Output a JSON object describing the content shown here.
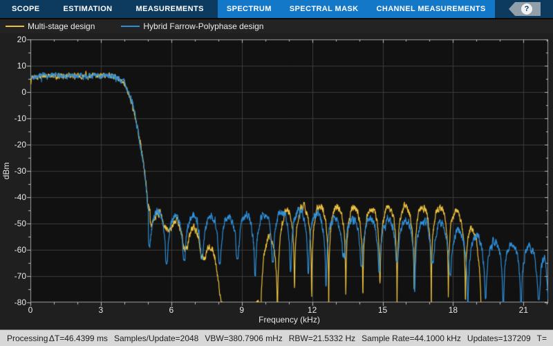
{
  "toolbar": {
    "tabs": [
      {
        "label": "SCOPE",
        "group": "main"
      },
      {
        "label": "ESTIMATION",
        "group": "main"
      },
      {
        "label": "MEASUREMENTS",
        "group": "main"
      },
      {
        "label": "SPECTRUM",
        "group": "contextual"
      },
      {
        "label": "SPECTRAL MASK",
        "group": "contextual"
      },
      {
        "label": "CHANNEL MEASUREMENTS",
        "group": "contextual"
      }
    ],
    "help_label": "?",
    "colors": {
      "main_bg": "#0d3b5f",
      "contextual_bg": "#1478c8"
    }
  },
  "legend": {
    "items": [
      {
        "label": "Multi-stage design",
        "color": "#EDC240"
      },
      {
        "label": "Hybrid Farrow-Polyphase design",
        "color": "#2E8FD9"
      }
    ]
  },
  "chart_data": {
    "type": "line",
    "title": "",
    "xlabel": "Frequency (kHz)",
    "ylabel": "dBm",
    "xlim": [
      0,
      22.05
    ],
    "ylim": [
      -80,
      20
    ],
    "x_ticks": [
      0,
      3,
      6,
      9,
      12,
      15,
      18,
      21
    ],
    "y_ticks": [
      20,
      10,
      0,
      -10,
      -20,
      -30,
      -40,
      -50,
      -60,
      -70,
      -80
    ],
    "x_minor_step": 1,
    "y_minor_step": 5,
    "grid": true,
    "legend_position": "top-left",
    "plot_bg": "#111111",
    "grid_color": "#3c3c3c",
    "axis_color": "#9e9e9e",
    "tick_color": "#c0c0c0",
    "series": [
      {
        "name": "Multi-stage design",
        "color": "#EDC240",
        "seed": 13,
        "envelope": [
          [
            0,
            5.8
          ],
          [
            0.6,
            6
          ],
          [
            1.6,
            6.1
          ],
          [
            2.6,
            6.2
          ],
          [
            3.4,
            6.2
          ],
          [
            3.75,
            5.2
          ],
          [
            4.05,
            2.5
          ],
          [
            4.3,
            -3
          ],
          [
            4.55,
            -13
          ],
          [
            4.75,
            -23
          ],
          [
            4.9,
            -33
          ],
          [
            5.0,
            -42
          ],
          [
            5.1,
            -45
          ],
          [
            5.4,
            -45.5
          ],
          [
            5.9,
            -47.5
          ],
          [
            6.4,
            -49.5
          ],
          [
            6.9,
            -51.5
          ],
          [
            7.3,
            -54
          ],
          [
            7.7,
            -58.5
          ],
          [
            7.95,
            -64
          ],
          [
            8.1,
            -73
          ],
          [
            8.2,
            -85
          ],
          [
            8.3,
            -97
          ],
          [
            9.4,
            -97
          ],
          [
            9.55,
            -84
          ],
          [
            9.7,
            -70
          ],
          [
            9.95,
            -58
          ],
          [
            10.2,
            -54.5
          ],
          [
            10.45,
            -56
          ],
          [
            10.65,
            -49
          ],
          [
            10.95,
            -44.5
          ],
          [
            11.4,
            -43.5
          ],
          [
            12.2,
            -43.5
          ],
          [
            13,
            -43.5
          ],
          [
            14,
            -44
          ],
          [
            15,
            -44
          ],
          [
            16,
            -43.5
          ],
          [
            17,
            -44
          ],
          [
            17.7,
            -43.5
          ],
          [
            18.05,
            -45
          ],
          [
            18.4,
            -46.5
          ],
          [
            18.75,
            -50
          ],
          [
            19.0,
            -56
          ],
          [
            19.15,
            -64
          ],
          [
            19.25,
            -78
          ],
          [
            19.35,
            -97
          ],
          [
            22.05,
            -97
          ]
        ],
        "lobes": [
          {
            "from": 5.1,
            "to": 8.15,
            "period": 0.76,
            "f0": 5.08,
            "dmin": 4,
            "dmax": 9
          },
          {
            "from": 9.6,
            "to": 19.3,
            "period": 0.728,
            "f0": 10.52,
            "dmin": 28,
            "dmax": 45
          }
        ],
        "noise": {
          "passband": 0.85,
          "stopband": 1.15,
          "split": 4.25
        }
      },
      {
        "name": "Hybrid Farrow-Polyphase design",
        "color": "#2E8FD9",
        "seed": 7,
        "envelope": [
          [
            0,
            5.8
          ],
          [
            0.5,
            6
          ],
          [
            1.5,
            6.2
          ],
          [
            2.5,
            6.1
          ],
          [
            3.3,
            6.3
          ],
          [
            3.7,
            5.5
          ],
          [
            4.0,
            3.5
          ],
          [
            4.25,
            -1
          ],
          [
            4.5,
            -11
          ],
          [
            4.7,
            -21
          ],
          [
            4.85,
            -30
          ],
          [
            5.0,
            -43
          ],
          [
            5.08,
            -46
          ],
          [
            5.45,
            -45.5
          ],
          [
            6,
            -47
          ],
          [
            7,
            -47
          ],
          [
            8,
            -47.5
          ],
          [
            9,
            -46.5
          ],
          [
            9.7,
            -47
          ],
          [
            10.3,
            -45.5
          ],
          [
            11,
            -45
          ],
          [
            11.6,
            -44.5
          ],
          [
            12.2,
            -46
          ],
          [
            13,
            -48
          ],
          [
            14,
            -48.5
          ],
          [
            15,
            -48
          ],
          [
            16,
            -48.5
          ],
          [
            17,
            -49
          ],
          [
            17.6,
            -50.5
          ],
          [
            18.3,
            -53
          ],
          [
            19.0,
            -55
          ],
          [
            19.6,
            -56.5
          ],
          [
            20.2,
            -57
          ],
          [
            21.0,
            -58
          ],
          [
            21.7,
            -60
          ],
          [
            21.9,
            -61
          ],
          [
            22.0,
            -72
          ],
          [
            22.05,
            -80
          ]
        ],
        "lobes": [
          {
            "from": 5.02,
            "to": 22.05,
            "period": 0.755,
            "f0": 5.04,
            "dmin": 11,
            "dmax": 30
          }
        ],
        "noise": {
          "passband": 0.85,
          "stopband": 1.3,
          "split": 4.2
        }
      }
    ]
  },
  "status_bar": {
    "state": "Processing",
    "items": [
      "ΔT=46.4399 ms",
      "Samples/Update=2048",
      "VBW=380.7906 mHz",
      "RBW=21.5332 Hz",
      "Sample Rate=44.1000 kHz",
      "Updates=137209",
      "T="
    ]
  }
}
